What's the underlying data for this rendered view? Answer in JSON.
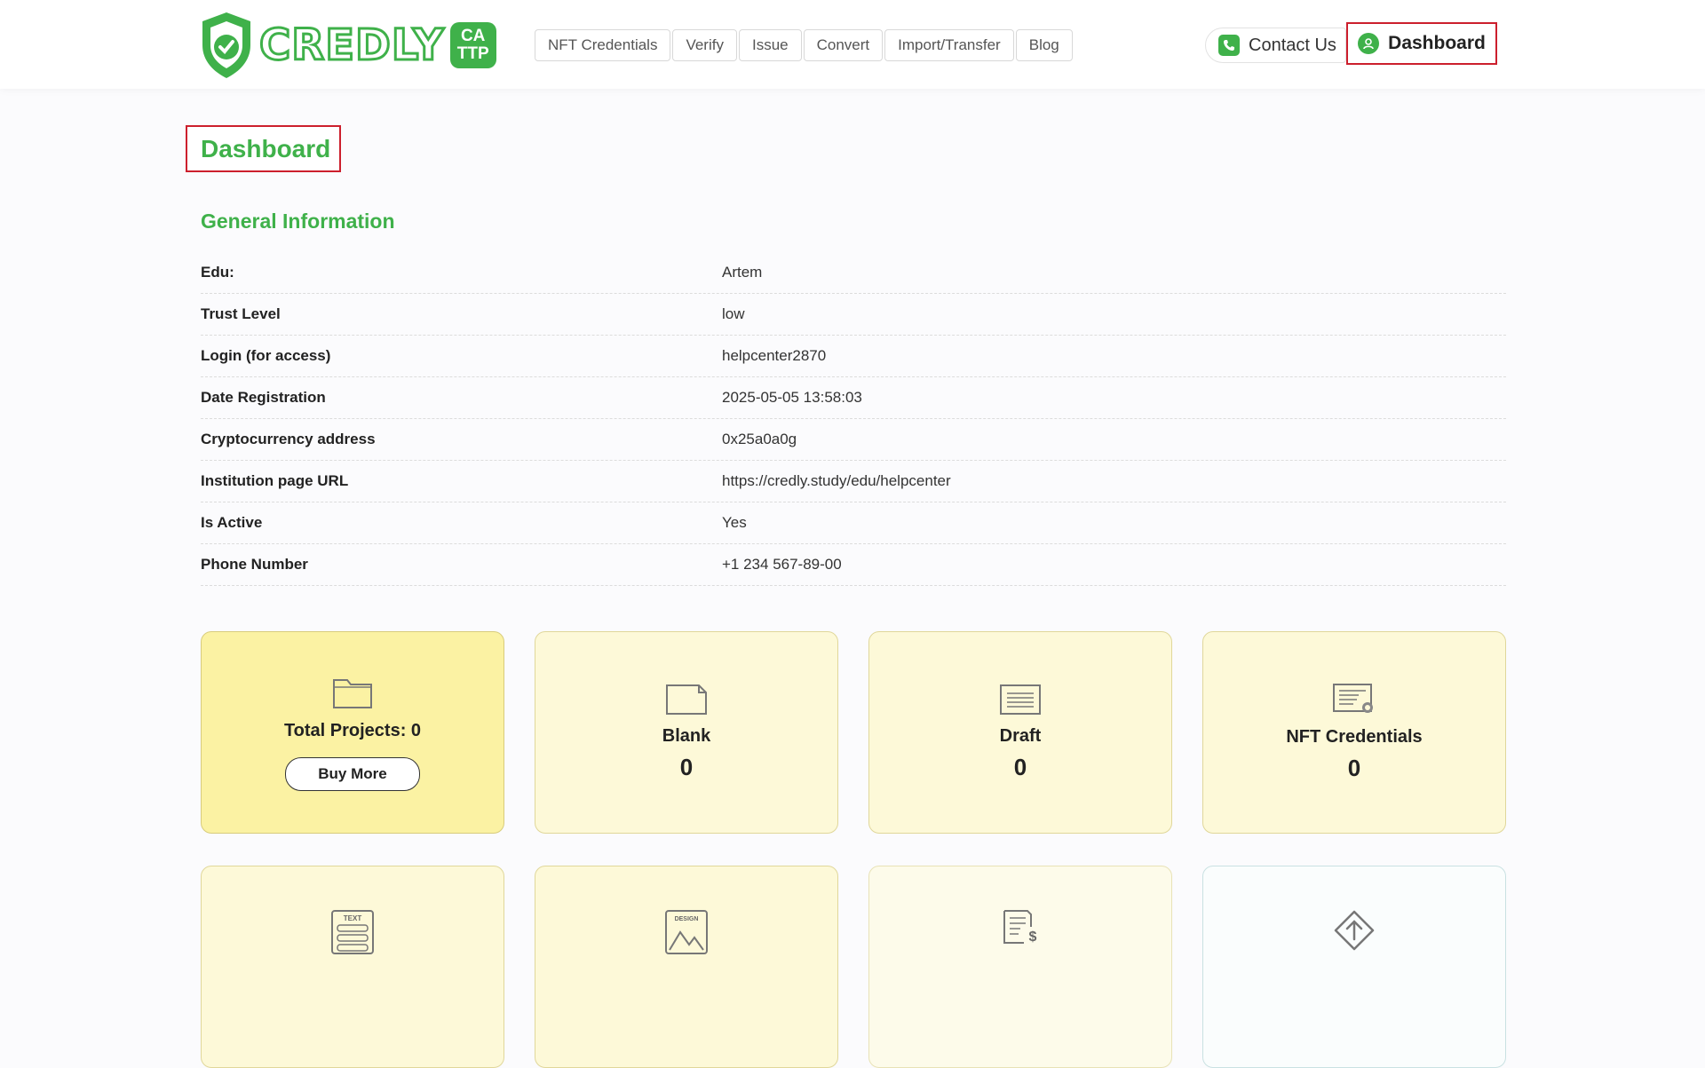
{
  "header": {
    "logo": {
      "text": "CREDLY",
      "badge_line1": "CA",
      "badge_line2": "TTP"
    },
    "nav": [
      {
        "label": "NFT Credentials"
      },
      {
        "label": "Verify"
      },
      {
        "label": "Issue"
      },
      {
        "label": "Convert"
      },
      {
        "label": "Import/Transfer"
      },
      {
        "label": "Blog"
      }
    ],
    "contact_label": "Contact Us",
    "dashboard_label": "Dashboard"
  },
  "page": {
    "title": "Dashboard",
    "section_title": "General Information"
  },
  "info": [
    {
      "label": "Edu:",
      "value": "Artem"
    },
    {
      "label": "Trust Level",
      "value": "low"
    },
    {
      "label": "Login (for access)",
      "value": "helpcenter2870"
    },
    {
      "label": "Date Registration",
      "value": "2025-05-05 13:58:03"
    },
    {
      "label": "Cryptocurrency address",
      "value": "0x25a0a0g"
    },
    {
      "label": "Institution page URL",
      "value": "https://credly.study/edu/helpcenter"
    },
    {
      "label": "Is Active",
      "value": "Yes"
    },
    {
      "label": "Phone Number",
      "value": "+1 234 567-89-00"
    }
  ],
  "cards": {
    "total": {
      "title": "Total Projects: 0",
      "button": "Buy More",
      "icon": "folder-icon"
    },
    "blank": {
      "title": "Blank",
      "count": "0",
      "icon": "blank-document-icon"
    },
    "draft": {
      "title": "Draft",
      "count": "0",
      "icon": "draft-document-icon"
    },
    "nft": {
      "title": "NFT Credentials",
      "count": "0",
      "icon": "certificate-icon"
    },
    "bottom_icons": [
      "text-template-icon",
      "design-template-icon",
      "invoice-icon",
      "upload-diamond-icon"
    ],
    "text_icon_label": "TEXT",
    "design_icon_label": "DESIGN"
  },
  "colors": {
    "brand_green": "#3fb14a",
    "highlight_red": "#cc1f2d",
    "card_yellow": "#fdf9d8",
    "card_yellow_strong": "#fbf2a3"
  }
}
